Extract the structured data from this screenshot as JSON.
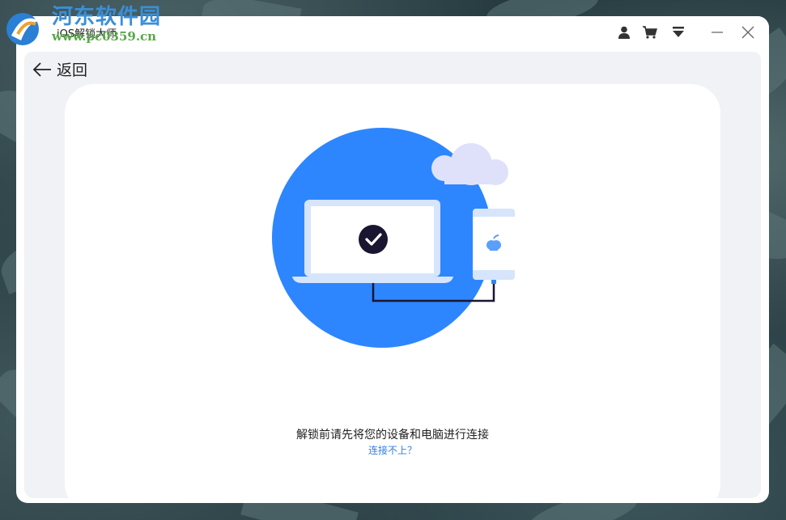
{
  "watermark": {
    "title": "河东软件园",
    "url": "www.pc0359.cn"
  },
  "window": {
    "title": "iOS解锁大师",
    "toolbar": {
      "icons": [
        "user-icon",
        "cart-icon",
        "menu-dropdown-icon",
        "minimize-icon",
        "close-icon"
      ]
    }
  },
  "back": {
    "label": "返回"
  },
  "main": {
    "instruction": "解锁前请先将您的设备和电脑进行连接",
    "help_link": "连接不上？"
  },
  "colors": {
    "accent": "#2d86fe",
    "link": "#2f7ee8",
    "dark": "#1a1530"
  }
}
